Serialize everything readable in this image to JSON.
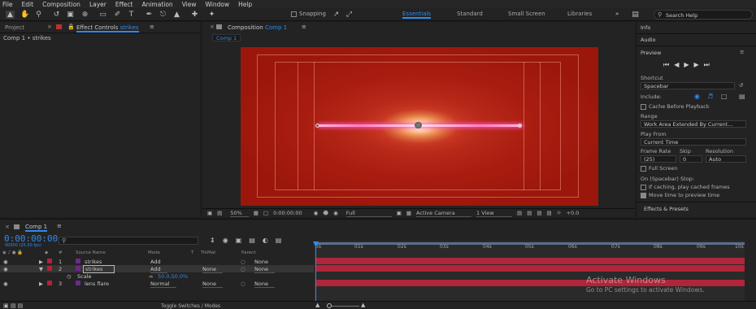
{
  "menu": [
    "File",
    "Edit",
    "Composition",
    "Layer",
    "Effect",
    "Animation",
    "View",
    "Window",
    "Help"
  ],
  "toolbar": {
    "snapping": "Snapping",
    "workspaces": [
      "Essentials",
      "Standard",
      "Small Screen",
      "Libraries"
    ],
    "active_workspace": "Essentials",
    "search_placeholder": "Search Help"
  },
  "left_panel": {
    "tab_project": "Project",
    "tab_effect_controls": "Effect Controls",
    "effect_controls_layer": "strikes",
    "breadcrumb": "Comp 1 • strikes"
  },
  "comp_panel": {
    "tab_label": "Composition",
    "comp_name": "Comp 1",
    "subtab": "Comp 1",
    "zoom": "50%",
    "timecode": "0:00:00:00",
    "resolution": "Full",
    "camera": "Active Camera",
    "views": "1 View",
    "exposure": "+0.0"
  },
  "right_panel": {
    "info": "Info",
    "audio": "Audio",
    "preview": "Preview",
    "shortcut_label": "Shortcut",
    "shortcut_value": "Spacebar",
    "include_label": "Include:",
    "cache_before_playback": "Cache Before Playback",
    "range_label": "Range",
    "range_value": "Work Area Extended By Current...",
    "play_from_label": "Play From",
    "play_from_value": "Current Time",
    "frame_rate_label": "Frame Rate",
    "skip_label": "Skip",
    "resolution_label": "Resolution",
    "frame_rate_value": "(25)",
    "skip_value": "0",
    "resolution_value": "Auto",
    "full_screen": "Full Screen",
    "on_stop_label": "On (Spacebar) Stop:",
    "if_caching": "If caching, play cached frames",
    "move_time": "Move time to preview time",
    "effects_presets": "Effects & Presets"
  },
  "timeline": {
    "tab": "Comp 1",
    "timecode": "0:00:00:00",
    "frame_info": "00000 (25.00 fps)",
    "columns": {
      "num": "#",
      "source_name": "Source Name",
      "mode": "Mode",
      "t": "T",
      "trkmat": "TrkMat",
      "parent": "Parent"
    },
    "layers": [
      {
        "num": "1",
        "name": "strikes",
        "mode": "Add",
        "trkmat": "",
        "parent": "None",
        "color": "#b1243a"
      },
      {
        "num": "2",
        "name": "strikes",
        "mode": "Add",
        "trkmat": "None",
        "parent": "None",
        "color": "#b1243a"
      },
      {
        "num": "3",
        "name": "lens flare",
        "mode": "Normal",
        "trkmat": "None",
        "parent": "None",
        "color": "#b1243a"
      }
    ],
    "property_scale_label": "Scale",
    "property_scale_value": "50.0,50.0%",
    "ruler": [
      "0s",
      "01s",
      "02s",
      "03s",
      "04s",
      "05s",
      "06s",
      "07s",
      "08s",
      "09s",
      "10s"
    ],
    "toggle_switches": "Toggle Switches / Modes"
  },
  "watermark": {
    "title": "Activate Windows",
    "subtitle": "Go to PC settings to activate Windows."
  },
  "colors": {
    "accent": "#2d8ceb",
    "layer_bar": "#b1243a",
    "work_area": "#5a6e8c"
  }
}
